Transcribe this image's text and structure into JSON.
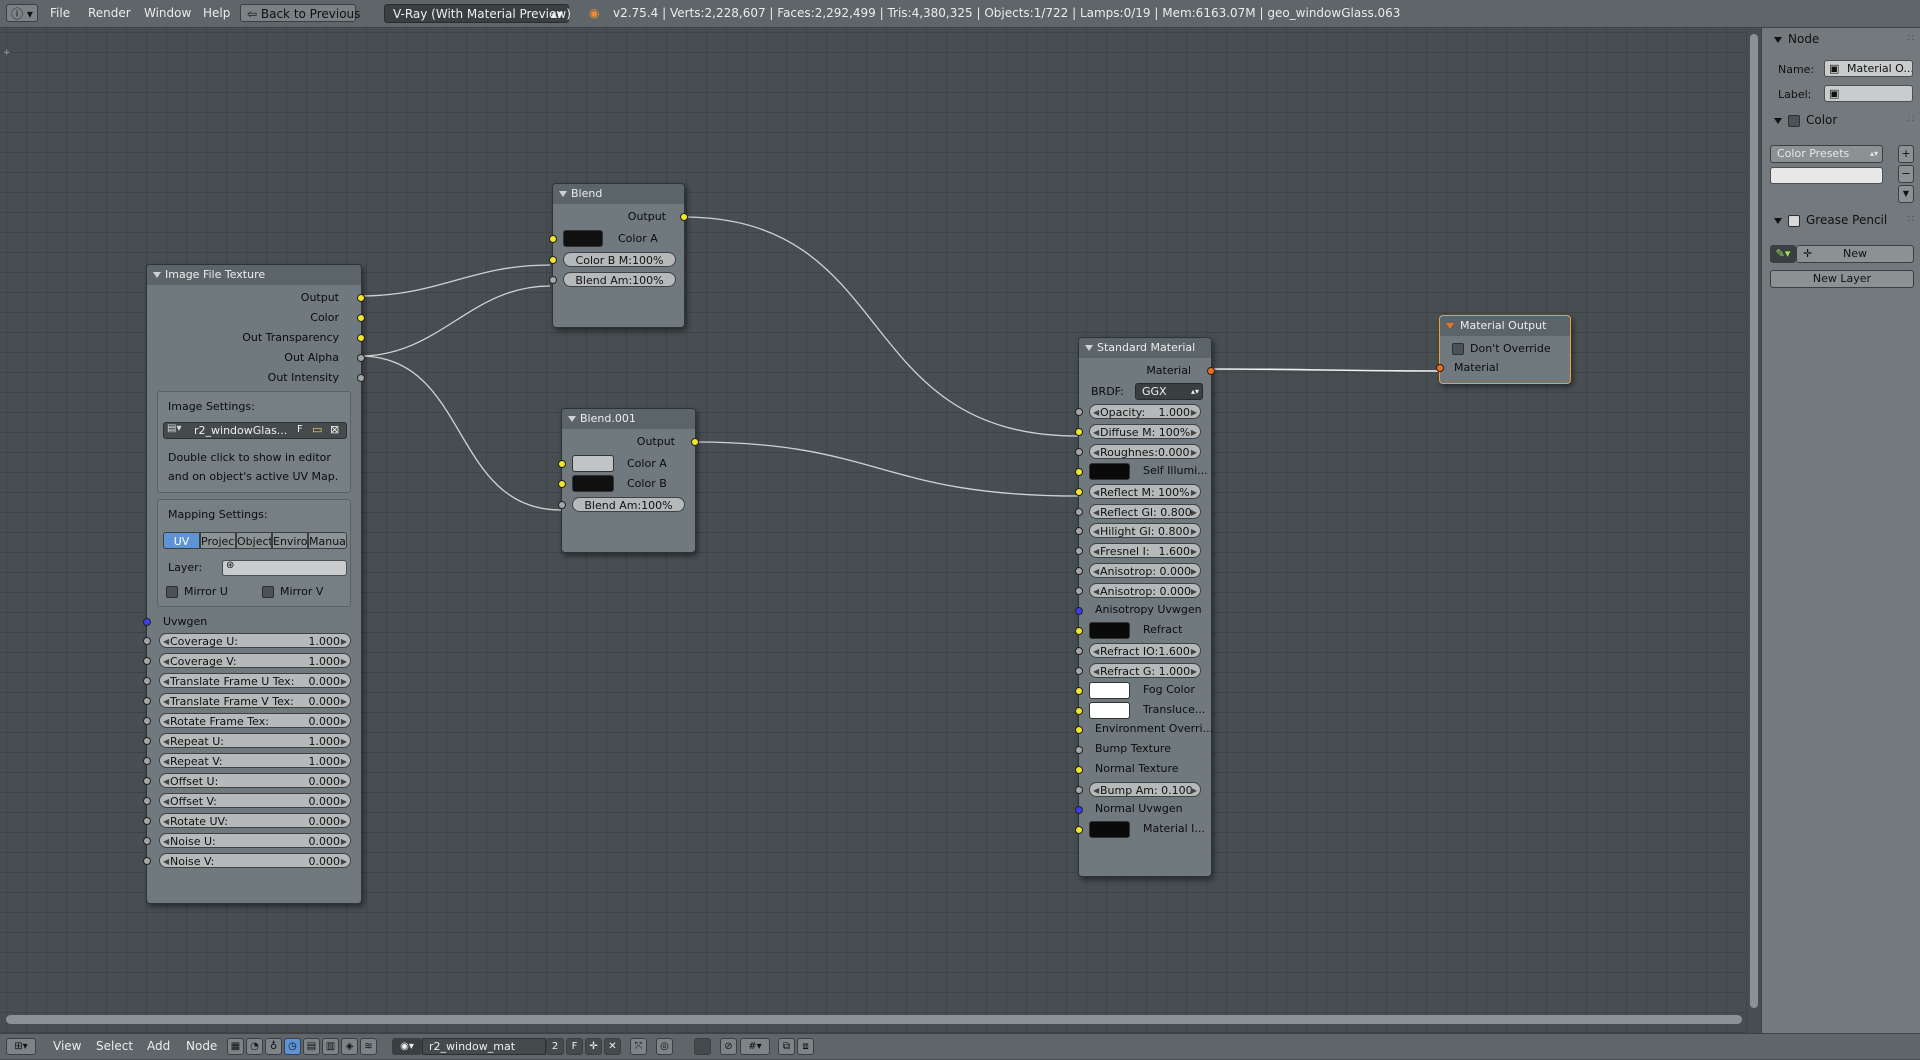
{
  "topbar": {
    "menus": [
      "File",
      "Render",
      "Window",
      "Help"
    ],
    "back_button": "Back to Previous",
    "engine": "V-Ray (With Material Preview)",
    "stats": "v2.75.4 | Verts:2,228,607 | Faces:2,292,499 | Tris:4,380,325 | Objects:1/722 | Lamps:0/19 | Mem:6163.07M | geo_windowGlass.063"
  },
  "nodes": {
    "image_texture": {
      "title": "Image File Texture",
      "outputs": [
        "Output",
        "Color",
        "Out Transparency",
        "Out Alpha",
        "Out Intensity"
      ],
      "image_settings_label": "Image Settings:",
      "image_name": "r2_windowGlas...",
      "image_flag": "F",
      "hint_line1": "Double click to show in editor",
      "hint_line2": "and on object's active UV Map.",
      "mapping_label": "Mapping Settings:",
      "mapping_tabs": [
        "UV",
        "Project",
        "Object",
        "Enviro",
        "Manual"
      ],
      "layer_label": "Layer:",
      "mirror_u": "Mirror U",
      "mirror_v": "Mirror V",
      "uvwgen": "Uvwgen",
      "params": [
        {
          "label": "Coverage U:",
          "value": "1.000"
        },
        {
          "label": "Coverage V:",
          "value": "1.000"
        },
        {
          "label": "Translate Frame U Tex:",
          "value": "0.000"
        },
        {
          "label": "Translate Frame V Tex:",
          "value": "0.000"
        },
        {
          "label": "Rotate Frame Tex:",
          "value": "0.000"
        },
        {
          "label": "Repeat U:",
          "value": "1.000"
        },
        {
          "label": "Repeat V:",
          "value": "1.000"
        },
        {
          "label": "Offset U:",
          "value": "0.000"
        },
        {
          "label": "Offset V:",
          "value": "0.000"
        },
        {
          "label": "Rotate UV:",
          "value": "0.000"
        },
        {
          "label": "Noise U:",
          "value": "0.000"
        },
        {
          "label": "Noise V:",
          "value": "0.000"
        }
      ]
    },
    "blend": {
      "title": "Blend",
      "output": "Output",
      "color_a": "Color A",
      "color_b": "Color B M:100%",
      "blend_amount": "Blend Am:100%"
    },
    "blend001": {
      "title": "Blend.001",
      "output": "Output",
      "color_a": "Color A",
      "color_b": "Color B",
      "blend_amount": "Blend Am:100%"
    },
    "standard": {
      "title": "Standard Material",
      "output": "Material",
      "brdf_label": "BRDF:",
      "brdf_value": "GGX",
      "opacity_label": "Opacity:",
      "opacity_value": "1.000",
      "diffuse": "Diffuse M: 100%",
      "roughness": "Roughnes:0.000",
      "self_illum": "Self Illumi...",
      "reflect": "Reflect M: 100%",
      "reflect_gl": "Reflect Gl: 0.800",
      "hilight_gl": "Hilight Gl: 0.800",
      "fresnel_label": "Fresnel I:",
      "fresnel_value": "1.600",
      "anisotrop1": "Anisotrop: 0.000",
      "anisotrop2": "Anisotrop: 0.000",
      "anisotropy_uvwgen": "Anisotropy Uvwgen",
      "refract": "Refract",
      "refract_io": "Refract IO:1.600",
      "refract_g": "Refract G: 1.000",
      "fog_color": "Fog Color",
      "transluce": "Transluce...",
      "env_override": "Environment Overri...",
      "bump_texture": "Bump Texture",
      "normal_texture": "Normal Texture",
      "bump_amount": "Bump Am: 0.100",
      "normal_uvwgen": "Normal Uvwgen",
      "material_i": "Material I..."
    },
    "output": {
      "title": "Material Output",
      "dont_override": "Don't Override",
      "material": "Material"
    }
  },
  "sidebar": {
    "node_header": "Node",
    "name_label": "Name:",
    "name_value": "Material O...",
    "label_label": "Label:",
    "label_value": "",
    "color_header": "Color",
    "color_presets": "Color Presets",
    "grease_header": "Grease Pencil",
    "new_button": "New",
    "new_layer_button": "New Layer"
  },
  "bottombar": {
    "menus": [
      "View",
      "Select",
      "Add",
      "Node"
    ],
    "material_name": "r2_window_mat",
    "users": "2",
    "fake_user": "F"
  },
  "colors": {
    "socket_yellow": "#f2e62a",
    "socket_grey": "#a6a6a6",
    "socket_blue": "#3c3cf0",
    "socket_orange": "#f07020",
    "selected_node_border": "#f0a030",
    "active_tab": "#5e93d6"
  }
}
